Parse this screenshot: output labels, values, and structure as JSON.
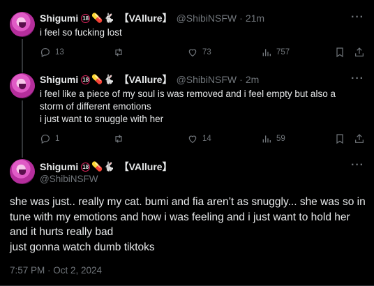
{
  "author": {
    "display_name": "Shigumi",
    "age_badge": "18",
    "emoji_pill": "💊",
    "emoji_bunny": "🐇",
    "tag": "【VAllure】",
    "handle": "@ShibiNSFW"
  },
  "posts": [
    {
      "time": "21m",
      "text_lines": [
        "i feel so fucking lost"
      ],
      "replies": "13",
      "reposts": "",
      "likes": "73",
      "views": "757"
    },
    {
      "time": "2m",
      "text_lines": [
        "i feel like a piece of my soul is was removed and i feel empty but also a storm of different emotions",
        "i just want to snuggle with her"
      ],
      "replies": "1",
      "reposts": "",
      "likes": "14",
      "views": "59"
    }
  ],
  "focus_post": {
    "text_lines": [
      "she was just.. really my cat. bumi and fia aren’t as snuggly... she was so in tune with my emotions and how i was feeling and i just want to hold her and it hurts really bad",
      "just gonna watch dumb tiktoks"
    ],
    "timestamp": "7:57 PM · Oct 2, 2024"
  },
  "ui": {
    "separator": "·",
    "more_glyph": "···",
    "colors": {
      "background": "#000000",
      "text": "#e7e9ea",
      "muted": "#71767b",
      "badge_red": "#e0245e"
    },
    "icons": [
      "reply-icon",
      "repost-icon",
      "like-icon",
      "views-icon",
      "bookmark-icon",
      "share-icon",
      "more-icon"
    ]
  }
}
